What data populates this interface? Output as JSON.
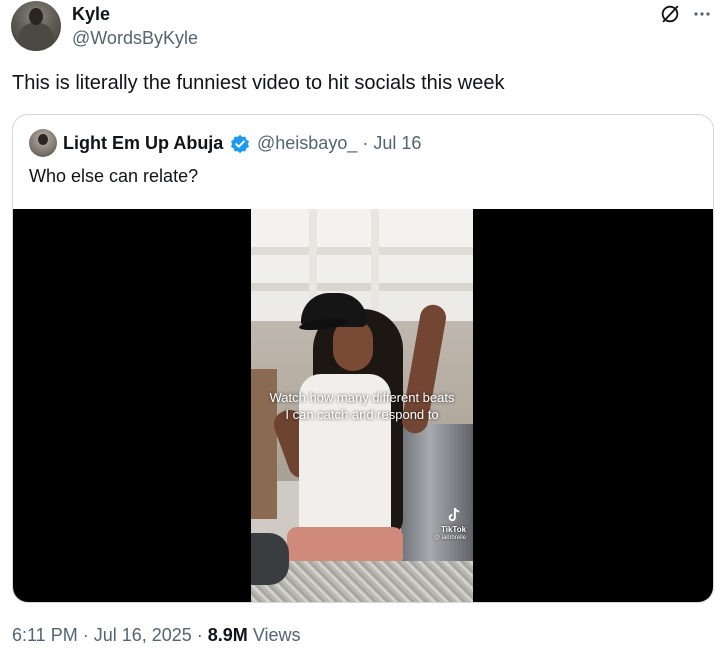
{
  "author": {
    "display_name": "Kyle",
    "handle": "@WordsByKyle"
  },
  "tweet": {
    "text": "This is literally the funniest video to hit socials this week"
  },
  "quoted": {
    "display_name": "Light Em Up Abuja",
    "handle_date": "@heisbayo_ · Jul 16",
    "text": "Who else can relate?",
    "verified": true,
    "verified_color": "#1d9bf0",
    "video": {
      "caption_line1": "Watch how many different beats",
      "caption_line2": "I can catch and respond to",
      "watermark_label": "TikTok",
      "watermark_user": "@ iambrelle"
    }
  },
  "footer": {
    "timestamp": "6:11 PM · Jul 16, 2025 · ",
    "views_count": "8.9M",
    "views_label": " Views"
  },
  "icons": {
    "grok": "grok-icon",
    "more": "more-icon",
    "verified": "verified-badge-icon",
    "tiktok": "tiktok-icon"
  },
  "colors": {
    "text_primary": "#0f1419",
    "text_secondary": "#536471",
    "border": "#cfd9de"
  }
}
